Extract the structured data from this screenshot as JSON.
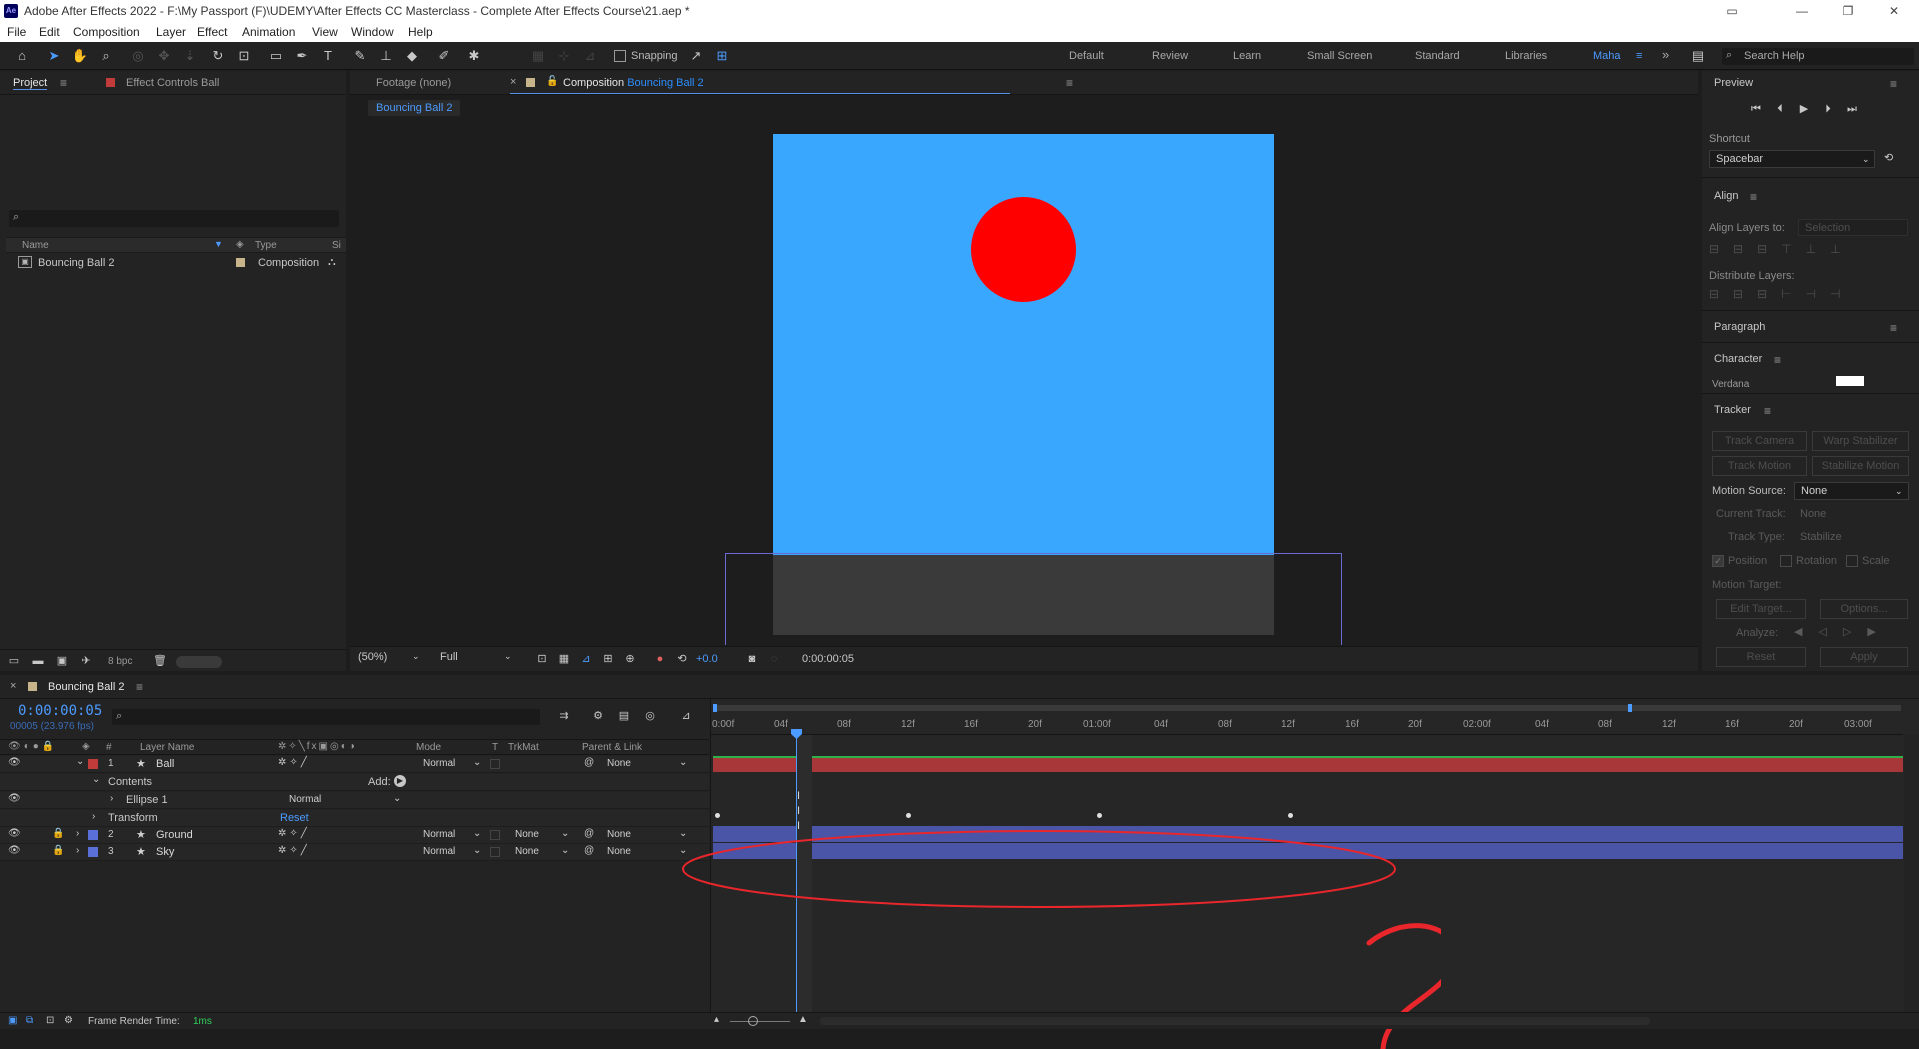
{
  "app": {
    "window_title": "Adobe After Effects 2022 - F:\\My Passport (F)\\UDEMY\\After Effects CC Masterclass - Complete After Effects Course\\21.aep *",
    "logo": "Ae"
  },
  "menu": [
    "File",
    "Edit",
    "Composition",
    "Layer",
    "Effect",
    "Animation",
    "View",
    "Window",
    "Help"
  ],
  "toolbar": {
    "snapping_label": "Snapping",
    "workspaces": [
      "Default",
      "Review",
      "Learn",
      "Small Screen",
      "Standard",
      "Libraries",
      "Maha"
    ],
    "active_workspace": "Maha",
    "search_placeholder": "Search Help"
  },
  "project": {
    "tab_project": "Project",
    "tab_effect_controls": "Effect Controls Ball",
    "columns": {
      "name": "Name",
      "type": "Type",
      "size": "Si"
    },
    "items": [
      {
        "name": "Bouncing Ball 2",
        "type": "Composition"
      }
    ],
    "bpc": "8 bpc"
  },
  "viewer": {
    "tab_footage": "Footage (none)",
    "tab_composition_prefix": "Composition",
    "tab_composition_name": "Bouncing Ball 2",
    "breadcrumb": "Bouncing Ball 2",
    "zoom": "(50%)",
    "resolution": "Full",
    "exposure": "+0.0",
    "timecode": "0:00:00:05",
    "colors": {
      "sky": "#3aa7ff",
      "ball": "#ff0000",
      "ground": "#3a3a3a",
      "bounds": "#6a6ad0"
    }
  },
  "right": {
    "preview_title": "Preview",
    "shortcut_label": "Shortcut",
    "shortcut_value": "Spacebar",
    "align_title": "Align",
    "align_layers_to_label": "Align Layers to:",
    "align_layers_to_value": "Selection",
    "distribute_label": "Distribute Layers:",
    "paragraph_title": "Paragraph",
    "character_title": "Character",
    "character_font": "Verdana",
    "tracker_title": "Tracker",
    "track_camera": "Track Camera",
    "warp_stabilizer": "Warp Stabilizer",
    "track_motion": "Track Motion",
    "stabilize_motion": "Stabilize Motion",
    "motion_source_label": "Motion Source:",
    "motion_source_value": "None",
    "current_track_label": "Current Track:",
    "current_track_value": "None",
    "track_type_label": "Track Type:",
    "track_type_value": "Stabilize",
    "position": "Position",
    "rotation": "Rotation",
    "scale": "Scale",
    "motion_target_label": "Motion Target:",
    "edit_target": "Edit Target...",
    "options": "Options...",
    "analyze": "Analyze:",
    "reset": "Reset",
    "apply": "Apply"
  },
  "timeline": {
    "comp_tab": "Bouncing Ball 2",
    "current_time": "0:00:00:05",
    "frame_info": "00005 (23.976 fps)",
    "columns": {
      "num": "#",
      "layer_name": "Layer Name",
      "mode": "Mode",
      "t": "T",
      "trkmat": "TrkMat",
      "parent": "Parent & Link"
    },
    "layers": [
      {
        "num": "1",
        "name": "Ball",
        "mode": "Normal",
        "trkmat": "",
        "parent": "None",
        "color": "#c23b3b"
      },
      {
        "num": "2",
        "name": "Ground",
        "mode": "Normal",
        "trkmat": "None",
        "parent": "None",
        "color": "#5b6fd8"
      },
      {
        "num": "3",
        "name": "Sky",
        "mode": "Normal",
        "trkmat": "None",
        "parent": "None",
        "color": "#5b6fd8"
      }
    ],
    "contents_label": "Contents",
    "add_label": "Add:",
    "ellipse_label": "Ellipse 1",
    "ellipse_mode": "Normal",
    "transform_label": "Transform",
    "reset_label": "Reset",
    "ruler_labels": [
      "0:00f",
      "04f",
      "08f",
      "12f",
      "16f",
      "20f",
      "01:00f",
      "04f",
      "08f",
      "12f",
      "16f",
      "20f",
      "02:00f",
      "04f",
      "08f",
      "12f",
      "16f",
      "20f",
      "03:00f"
    ],
    "frame_render_label": "Frame Render Time:",
    "frame_render_value": "1ms"
  },
  "annotation": {
    "question_mark": "?",
    "color": "#e8262b"
  }
}
